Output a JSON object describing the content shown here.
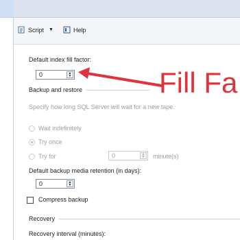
{
  "toolbar": {
    "script_label": "Script",
    "help_label": "Help"
  },
  "fill_factor": {
    "label": "Default index fill factor:",
    "value": "0"
  },
  "backup": {
    "section_label": "Backup and restore",
    "description": "Specify how long SQL Server will wait for a new tape.",
    "options": [
      {
        "label": "Wait indefinitely",
        "checked": false
      },
      {
        "label": "Try once",
        "checked": true
      },
      {
        "label": "Try for",
        "checked": false
      }
    ],
    "try_for_value": "0",
    "minutes_label": "minute(s)",
    "retention_label": "Default backup media retention (in days):",
    "retention_value": "0",
    "compress_label": "Compress backup"
  },
  "recovery": {
    "section_label": "Recovery",
    "interval_label": "Recovery interval (minutes):"
  },
  "annotation": {
    "text": "Fill Fa",
    "color": "#e0323a"
  }
}
